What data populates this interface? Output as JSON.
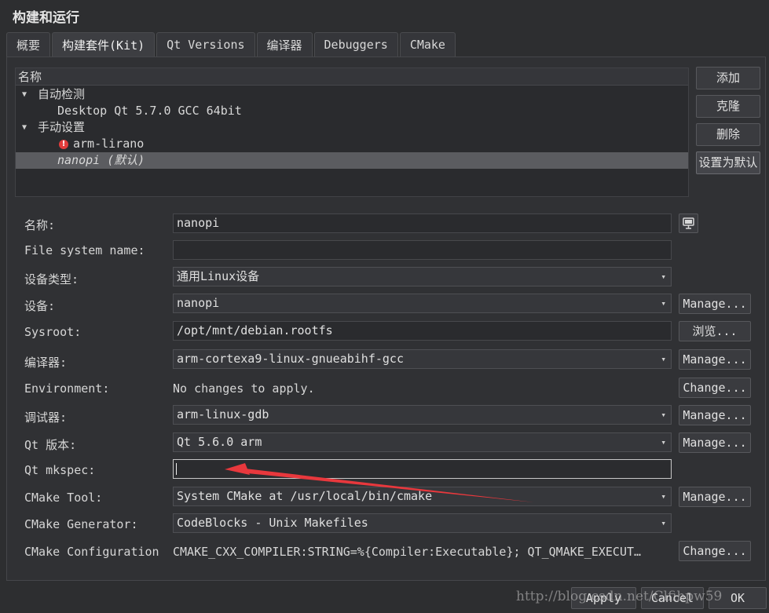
{
  "window": {
    "title": "构建和运行"
  },
  "tabs": [
    {
      "label": "概要"
    },
    {
      "label": "构建套件(Kit)",
      "active": true
    },
    {
      "label": "Qt Versions"
    },
    {
      "label": "编译器"
    },
    {
      "label": "Debuggers"
    },
    {
      "label": "CMake"
    }
  ],
  "kit_tree": {
    "header": "名称",
    "groups": [
      {
        "label": "自动检测",
        "items": [
          "Desktop Qt 5.7.0 GCC 64bit"
        ]
      },
      {
        "label": "手动设置",
        "items": [
          "arm-lirano",
          "nanopi (默认)"
        ]
      }
    ],
    "error_mark": "!"
  },
  "side_buttons": {
    "add": "添加",
    "clone": "克隆",
    "remove": "删除",
    "make_default": "设置为默认"
  },
  "form": {
    "name": {
      "label": "名称:",
      "value": "nanopi"
    },
    "fs_name": {
      "label": "File system name:",
      "value": ""
    },
    "device_type": {
      "label": "设备类型:",
      "value": "通用Linux设备"
    },
    "device": {
      "label": "设备:",
      "value": "nanopi",
      "button": "Manage..."
    },
    "sysroot": {
      "label": "Sysroot:",
      "value": "/opt/mnt/debian.rootfs",
      "button": "浏览..."
    },
    "compiler": {
      "label": "编译器:",
      "value": "arm-cortexa9-linux-gnueabihf-gcc",
      "button": "Manage..."
    },
    "environment": {
      "label": "Environment:",
      "value": "No changes to apply.",
      "button": "Change..."
    },
    "debugger": {
      "label": "调试器:",
      "value": "arm-linux-gdb",
      "button": "Manage..."
    },
    "qt_version": {
      "label": "Qt 版本:",
      "value": "Qt 5.6.0  arm",
      "button": "Manage..."
    },
    "qt_mkspec": {
      "label": "Qt mkspec:",
      "value": ""
    },
    "cmake_tool": {
      "label": "CMake Tool:",
      "value": "System CMake at /usr/local/bin/cmake",
      "button": "Manage..."
    },
    "cmake_generator": {
      "label": "CMake Generator:",
      "value": "CodeBlocks - Unix Makefiles"
    },
    "cmake_config": {
      "label": "CMake Configuration",
      "value": "CMAKE_CXX_COMPILER:STRING=%{Compiler:Executable}; QT_QMAKE_EXECUT…",
      "button": "Change..."
    }
  },
  "dialog_buttons": {
    "apply": "Apply",
    "cancel": "Cancel",
    "ok": "OK"
  },
  "watermark": "http://blog.csdn.net/Clfihpw59",
  "colors": {
    "background": "#2d2e30",
    "selection": "#5b5c60",
    "error": "#e23c3c",
    "arrow": "#e8383d"
  },
  "icons": {
    "device_icon": "monitor-icon",
    "expander": "triangle-down-icon",
    "combo": "chevron-down-icon"
  }
}
